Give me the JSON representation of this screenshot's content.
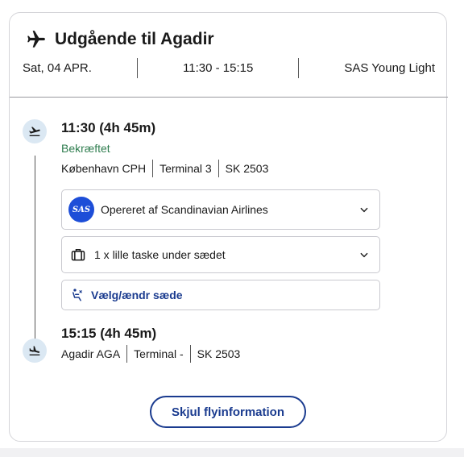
{
  "header": {
    "title": "Udgående til Agadir",
    "date": "Sat, 04 APR.",
    "time_range": "11:30 - 15:15",
    "fare": "SAS Young Light"
  },
  "departure": {
    "time": "11:30  (4h 45m)",
    "status": "Bekræftet",
    "city": "København  CPH",
    "terminal": "Terminal  3",
    "flight": "SK 2503"
  },
  "operator": {
    "logo_text": "SAS",
    "label": "Opereret af Scandinavian Airlines"
  },
  "baggage": {
    "label": "1 x lille taske under sædet"
  },
  "seat": {
    "label": "Vælg/ændr sæde"
  },
  "arrival": {
    "time": "15:15  (4h 45m)",
    "city": "Agadir  AGA",
    "terminal": "Terminal  -",
    "flight": "SK 2503"
  },
  "toggle_button": {
    "label": "Skjul flyinformation"
  },
  "colors": {
    "brand_blue": "#1a3b8f",
    "status_green": "#2f7d4f",
    "icon_circle": "#dbe8f3",
    "sas_logo_blue": "#1d4ed8"
  },
  "icons": {
    "header": "airplane-icon",
    "departure": "takeoff-icon",
    "arrival": "landing-icon",
    "operator": "sas-logo",
    "baggage": "bag-icon",
    "seat": "seat-icon",
    "expand": "chevron-down-icon"
  }
}
